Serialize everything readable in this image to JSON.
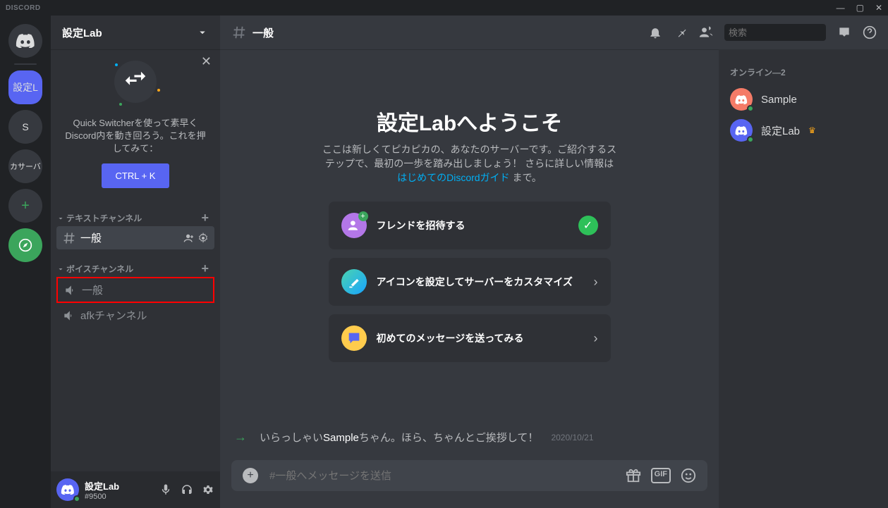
{
  "titlebar": {
    "brand": "DISCORD"
  },
  "guilds": {
    "selected_label": "設定L",
    "s_label": "S",
    "japan_label": "カサーバ"
  },
  "server": {
    "name": "設定Lab"
  },
  "quick_switcher": {
    "text": "Quick Switcherを使って素早くDiscord内を動き回ろう。これを押してみて：",
    "button": "CTRL + K"
  },
  "categories": {
    "text": {
      "label": "テキストチャンネル"
    },
    "voice": {
      "label": "ボイスチャンネル"
    }
  },
  "channels": {
    "text_general": "一般",
    "voice_general": "一般",
    "voice_afk": "afkチャンネル"
  },
  "user": {
    "name": "設定Lab",
    "tag": "#9500"
  },
  "chat_header": {
    "channel": "一般",
    "search_placeholder": "検索"
  },
  "welcome": {
    "title": "設定Labへようこそ",
    "desc_pre": "ここは新しくてピカピカの、あなたのサーバーです。ご紹介するステップで、最初の一歩を踏み出しましょう！ さらに詳しい情報は ",
    "desc_link": "はじめてのDiscordガイド",
    "desc_post": " まで。"
  },
  "onboard": {
    "invite": "フレンドを招待する",
    "icon": "アイコンを設定してサーバーをカスタマイズ",
    "message": "初めてのメッセージを送ってみる"
  },
  "system_message": {
    "pre": "いらっしゃい",
    "user": "Sample",
    "post": "ちゃん。ほら、ちゃんとご挨拶して！",
    "timestamp": "2020/10/21"
  },
  "composer": {
    "placeholder": "#一般へメッセージを送信"
  },
  "members": {
    "header": "オンライン—2",
    "sample": "Sample",
    "owner": "設定Lab"
  }
}
